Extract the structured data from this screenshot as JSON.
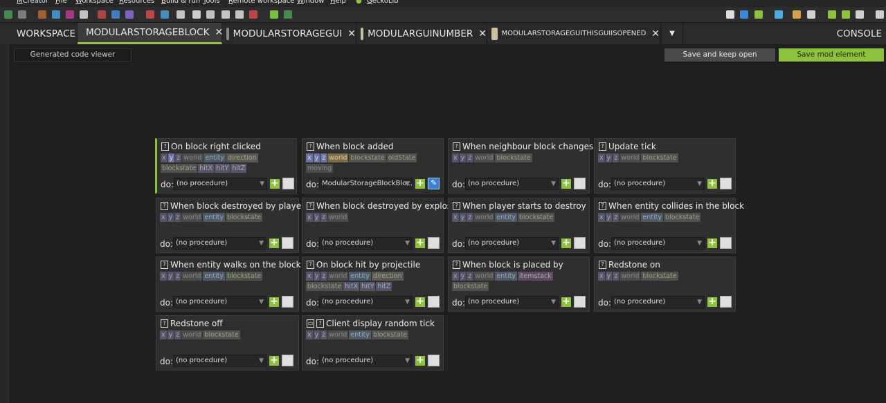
{
  "menu": [
    "MCreator",
    "File",
    "Workspace",
    "Resources",
    "Build & run",
    "Tools",
    "Remote workspace",
    "Window",
    "Help",
    "GeckoLib"
  ],
  "tabs": [
    {
      "label": "WORKSPACE",
      "closable": false,
      "active": false
    },
    {
      "label": "MODULARSTORAGEBLOCK",
      "closable": true,
      "active": true,
      "icon": "block-icon"
    },
    {
      "label": "MODULARSTORAGEGUI",
      "closable": true,
      "active": false,
      "icon": "gui-icon"
    },
    {
      "label": "MODULARGUINUMBER",
      "closable": true,
      "active": false,
      "icon": "folder-icon"
    },
    {
      "label": "MODULARSTORAGEGUITHISGUIISOPENED",
      "closable": true,
      "active": false,
      "icon": "folder-icon"
    }
  ],
  "console_label": "CONSOLE",
  "code_viewer": "Generated code viewer",
  "buttons": {
    "keep": "Save and keep open",
    "save": "Save mod element"
  },
  "do_label": "do:",
  "colors": {
    "accent": "#8dc23f",
    "background": "#1f1f1f",
    "card": "#2f2f2f"
  },
  "triggers": [
    {
      "title": "On block right clicked",
      "params": [
        [
          "x",
          "num"
        ],
        [
          "y",
          "blue"
        ],
        [
          "z",
          "num"
        ],
        [
          "world",
          "dim"
        ],
        [
          "entity",
          "ent"
        ],
        [
          "direction",
          "dir"
        ],
        [
          "blockstate",
          "bs"
        ],
        [
          "hitX",
          "hit"
        ],
        [
          "hitY",
          "hit"
        ],
        [
          "hitZ",
          "hit"
        ]
      ],
      "procedure": "(no procedure)",
      "accent": true
    },
    {
      "title": "When block added",
      "params": [
        [
          "x",
          "blue"
        ],
        [
          "y",
          "blue"
        ],
        [
          "z",
          "blue"
        ],
        [
          "world",
          "world"
        ],
        [
          "blockstate",
          "bs"
        ],
        [
          "oldState",
          "bs"
        ],
        [
          "moving",
          "dim"
        ]
      ],
      "procedure": "ModularStorageBlockBloc...",
      "edit": "pen"
    },
    {
      "title": "When neighbour block changes",
      "params": [
        [
          "x",
          "num"
        ],
        [
          "y",
          "num"
        ],
        [
          "z",
          "num"
        ],
        [
          "world",
          "dim"
        ],
        [
          "blockstate",
          "bs"
        ]
      ],
      "procedure": "(no procedure)"
    },
    {
      "title": "Update tick",
      "params": [
        [
          "x",
          "num"
        ],
        [
          "y",
          "num"
        ],
        [
          "z",
          "num"
        ],
        [
          "world",
          "dim"
        ],
        [
          "blockstate",
          "bs"
        ]
      ],
      "procedure": "(no procedure)"
    },
    {
      "title": "When block destroyed by player",
      "params": [
        [
          "x",
          "num"
        ],
        [
          "y",
          "num"
        ],
        [
          "z",
          "num"
        ],
        [
          "world",
          "dim"
        ],
        [
          "entity",
          "ent"
        ],
        [
          "blockstate",
          "bs"
        ]
      ],
      "procedure": "(no procedure)"
    },
    {
      "title": "When block destroyed by explosion",
      "params": [
        [
          "x",
          "num"
        ],
        [
          "y",
          "num"
        ],
        [
          "z",
          "num"
        ],
        [
          "world",
          "dim"
        ]
      ],
      "procedure": "(no procedure)"
    },
    {
      "title": "When player starts to destroy",
      "params": [
        [
          "x",
          "num"
        ],
        [
          "y",
          "num"
        ],
        [
          "z",
          "num"
        ],
        [
          "world",
          "dim"
        ],
        [
          "entity",
          "ent"
        ],
        [
          "blockstate",
          "bs"
        ]
      ],
      "procedure": "(no procedure)"
    },
    {
      "title": "When entity collides in the block",
      "params": [
        [
          "x",
          "num"
        ],
        [
          "y",
          "num"
        ],
        [
          "z",
          "num"
        ],
        [
          "world",
          "dim"
        ],
        [
          "entity",
          "ent"
        ],
        [
          "blockstate",
          "bs"
        ]
      ],
      "procedure": "(no procedure)"
    },
    {
      "title": "When entity walks on the block",
      "params": [
        [
          "x",
          "num"
        ],
        [
          "y",
          "num"
        ],
        [
          "z",
          "num"
        ],
        [
          "world",
          "dim"
        ],
        [
          "entity",
          "ent"
        ],
        [
          "blockstate",
          "bs"
        ]
      ],
      "procedure": "(no procedure)"
    },
    {
      "title": "On block hit by projectile",
      "params": [
        [
          "x",
          "num"
        ],
        [
          "y",
          "num"
        ],
        [
          "z",
          "num"
        ],
        [
          "world",
          "dim"
        ],
        [
          "entity",
          "ent"
        ],
        [
          "direction",
          "dir"
        ],
        [
          "blockstate",
          "bs"
        ],
        [
          "hitX",
          "hit"
        ],
        [
          "hitY",
          "hit"
        ],
        [
          "hitZ",
          "hit"
        ]
      ],
      "procedure": "(no procedure)"
    },
    {
      "title": "When block is placed by",
      "params": [
        [
          "x",
          "num"
        ],
        [
          "y",
          "num"
        ],
        [
          "z",
          "num"
        ],
        [
          "world",
          "dim"
        ],
        [
          "entity",
          "ent"
        ],
        [
          "itemstack",
          "item"
        ],
        [
          "blockstate",
          "bs"
        ]
      ],
      "procedure": "(no procedure)"
    },
    {
      "title": "Redstone on",
      "params": [
        [
          "x",
          "num"
        ],
        [
          "y",
          "num"
        ],
        [
          "z",
          "num"
        ],
        [
          "world",
          "dim"
        ],
        [
          "blockstate",
          "bs"
        ]
      ],
      "procedure": "(no procedure)"
    },
    {
      "title": "Redstone off",
      "params": [
        [
          "x",
          "num"
        ],
        [
          "y",
          "num"
        ],
        [
          "z",
          "num"
        ],
        [
          "world",
          "dim"
        ],
        [
          "blockstate",
          "bs"
        ]
      ],
      "procedure": "(no procedure)"
    },
    {
      "title": "Client display random tick",
      "params": [
        [
          "x",
          "num"
        ],
        [
          "y",
          "num"
        ],
        [
          "z",
          "num"
        ],
        [
          "world",
          "dim"
        ],
        [
          "entity",
          "ent"
        ],
        [
          "blockstate",
          "bs"
        ]
      ],
      "procedure": "(no procedure)",
      "client": true
    }
  ]
}
